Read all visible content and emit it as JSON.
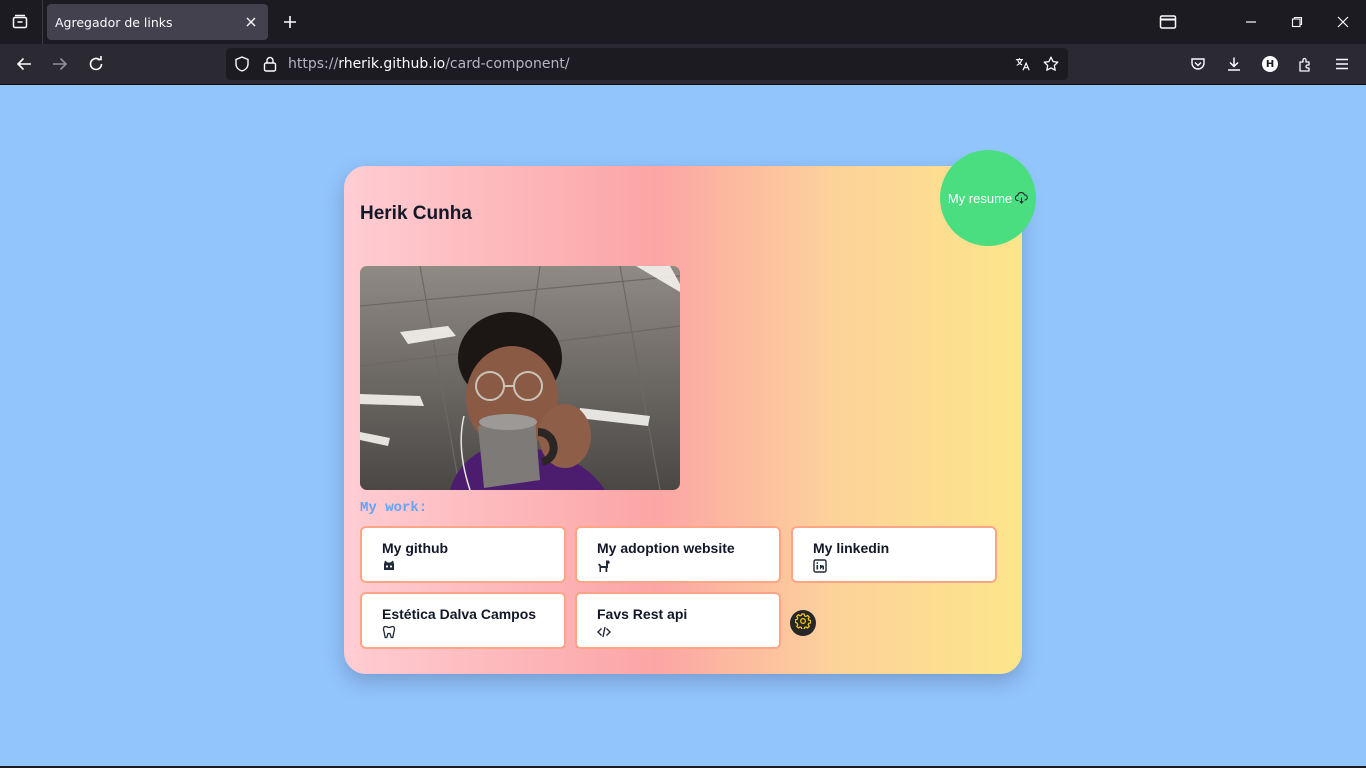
{
  "browser": {
    "tab": {
      "title": "Agregador de links"
    },
    "url": {
      "scheme": "https://",
      "host": "rherik.github.io",
      "path": "/card-component/"
    },
    "icons": {
      "tab_list": "tab-list-icon",
      "close_tab": "close-icon",
      "new_tab": "plus-icon",
      "window": [
        "tab-view-icon",
        "minimize-icon",
        "restore-icon",
        "close-window-icon"
      ],
      "nav": [
        "back-icon",
        "forward-icon",
        "reload-icon"
      ],
      "urlbar": [
        "tracking-shield-icon",
        "lock-icon",
        "translate-icon",
        "bookmark-star-icon"
      ],
      "toolbar": [
        "pocket-icon",
        "download-icon",
        "profile-avatar-icon",
        "extensions-icon",
        "menu-icon"
      ]
    },
    "profile_initial": "H"
  },
  "card": {
    "name": "Herik Cunha",
    "resume_button": {
      "label": "My resume",
      "icon": "cloud-download-icon"
    },
    "photo_alt": "Photo of Herik drinking from a mug",
    "work_label": "My work:",
    "links": [
      {
        "title": "My github",
        "icon": "github-icon"
      },
      {
        "title": "My adoption website",
        "icon": "dog-icon"
      },
      {
        "title": "My linkedin",
        "icon": "linkedin-icon"
      },
      {
        "title": "Estética Dalva Campos",
        "icon": "tooth-icon"
      },
      {
        "title": "Favs Rest api",
        "icon": "code-icon"
      }
    ],
    "theme_button": {
      "icon": "gear-icon"
    }
  },
  "colors": {
    "page_background": "#93c5fd",
    "resume_button": "#4ade80",
    "work_label": "#60a5fa",
    "link_border": "#fda585",
    "card_gradient": [
      "#fecdd3",
      "#fca5a5",
      "#fcd29a",
      "#fde68a"
    ]
  }
}
